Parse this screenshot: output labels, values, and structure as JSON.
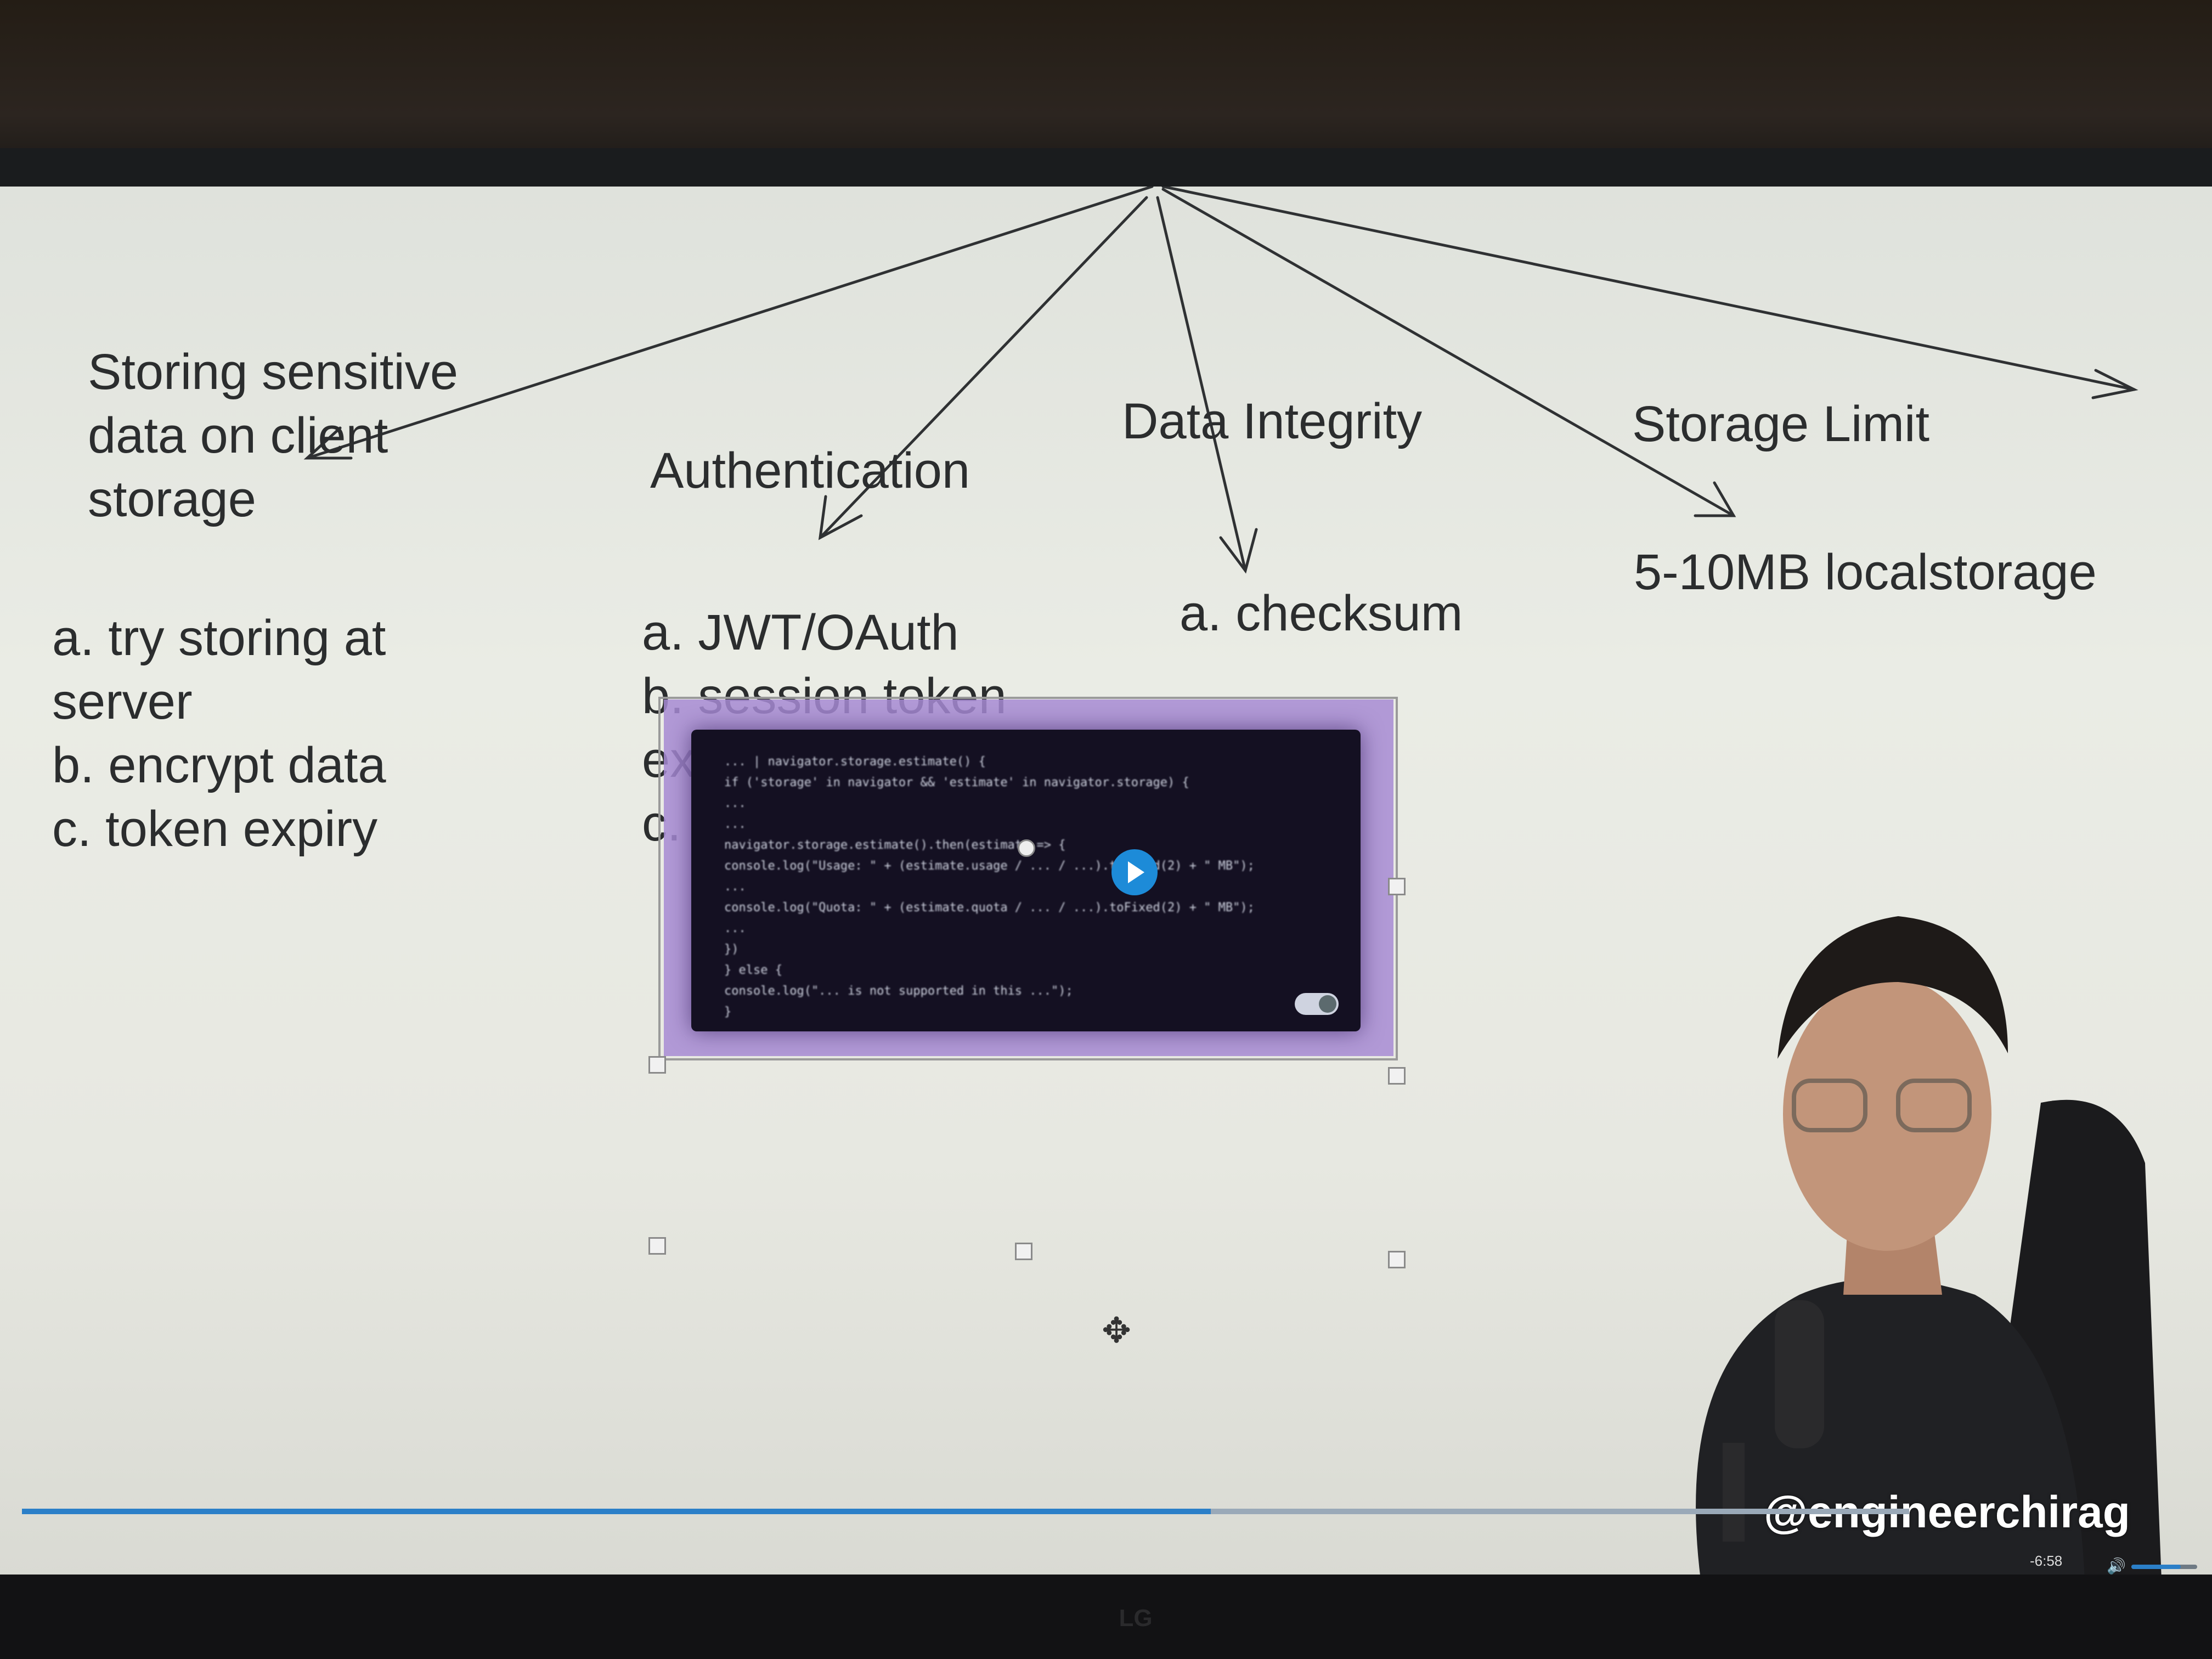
{
  "slide": {
    "branches": [
      {
        "heading_lines": [
          "Storing sensitive",
          "data on client",
          "storage"
        ],
        "points": [
          "a. try storing at",
          "server",
          "b. encrypt data",
          "c. token expiry"
        ]
      },
      {
        "heading": "Authentication",
        "points": [
          "a. JWT/OAuth",
          "b. session token",
          "ex",
          "c."
        ]
      },
      {
        "heading": "Data Integrity",
        "points": [
          "a. checksum"
        ]
      },
      {
        "heading": "Storage Limit",
        "value": "5-10MB localstorage"
      }
    ],
    "code_snippet": {
      "lines": [
        "... | navigator.storage.estimate() {",
        "  if ('storage' in navigator && 'estimate' in navigator.storage) {",
        "     ...",
        "     ...",
        "  navigator.storage.estimate().then(estimate => {",
        "     console.log(\"Usage: \" + (estimate.usage / ... / ...).toFixed(2) + \" MB\");",
        "  ...",
        "     console.log(\"Quota: \" + (estimate.quota / ... / ...).toFixed(2) + \" MB\");",
        "  ...",
        "  })",
        "} else {",
        "  console.log(\"... is not supported in this ...\");",
        "}"
      ]
    }
  },
  "webcam": {
    "channel_handle": "@engineerchirag"
  },
  "player": {
    "time_remaining": "-6:58",
    "progress": 0.63,
    "volume": 0.75
  },
  "monitor": {
    "brand": "LG"
  },
  "colors": {
    "slide_background": "#e7e8e1",
    "text": "#2b2d2e",
    "snippet_glow": "#a78bd4",
    "code_background": "#141022",
    "play_button": "#1d8bd8",
    "progress": "#2b7fc8"
  }
}
